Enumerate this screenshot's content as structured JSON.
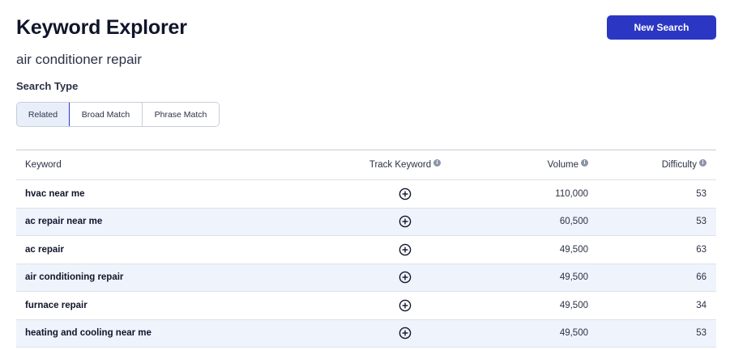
{
  "header": {
    "title": "Keyword Explorer",
    "query": "air conditioner repair",
    "new_search_label": "New Search"
  },
  "search_type": {
    "label": "Search Type",
    "options": [
      "Related",
      "Broad Match",
      "Phrase Match"
    ],
    "selected": "Related"
  },
  "table": {
    "columns": {
      "keyword": "Keyword",
      "track": "Track Keyword",
      "volume": "Volume",
      "difficulty": "Difficulty"
    },
    "info_icon": "info-icon",
    "track_icon": "plus-circle-icon",
    "rows": [
      {
        "keyword": "hvac near me",
        "volume": "110,000",
        "difficulty": "53"
      },
      {
        "keyword": "ac repair near me",
        "volume": "60,500",
        "difficulty": "53"
      },
      {
        "keyword": "ac repair",
        "volume": "49,500",
        "difficulty": "63"
      },
      {
        "keyword": "air conditioning repair",
        "volume": "49,500",
        "difficulty": "66"
      },
      {
        "keyword": "furnace repair",
        "volume": "49,500",
        "difficulty": "34"
      },
      {
        "keyword": "heating and cooling near me",
        "volume": "49,500",
        "difficulty": "53"
      }
    ]
  },
  "colors": {
    "primary": "#2b37c3",
    "row_alt": "#eef3fc",
    "border": "#c8ccd6"
  }
}
